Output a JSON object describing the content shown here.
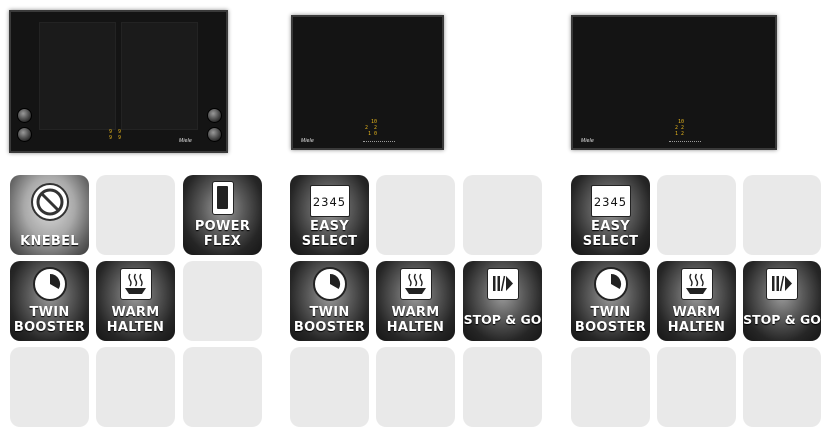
{
  "cooktops": [
    {
      "id": "cooktop-1",
      "brand": "Miele",
      "display": "9  9\n9  9"
    },
    {
      "id": "cooktop-2",
      "brand": "Miele",
      "display": "  10\n2  2\n 1 0"
    },
    {
      "id": "cooktop-3",
      "brand": "Miele",
      "display": "  10\n 2 2\n 1 2"
    }
  ],
  "features": {
    "knebel": {
      "label": "KNEBEL",
      "icon": "prohibited-circle-icon"
    },
    "powerflex": {
      "label": "POWER\nFLEX",
      "icon": "powerflex-zone-icon"
    },
    "easy_select": {
      "label": "EASY\nSELECT",
      "digits": "2345",
      "icon": "number-row-icon"
    },
    "twin_booster": {
      "label": "TWIN\nBOOSTER",
      "icon": "timer-icon"
    },
    "warm_halten": {
      "label": "WARM\nHALTEN",
      "icon": "steaming-pot-icon"
    },
    "stop_go": {
      "label": "STOP & GO",
      "icon": "pause-play-icon"
    }
  },
  "colors": {
    "display_digits": "#e5b41c",
    "tile_empty": "#e9e9e9",
    "cooktop": "#141414"
  }
}
